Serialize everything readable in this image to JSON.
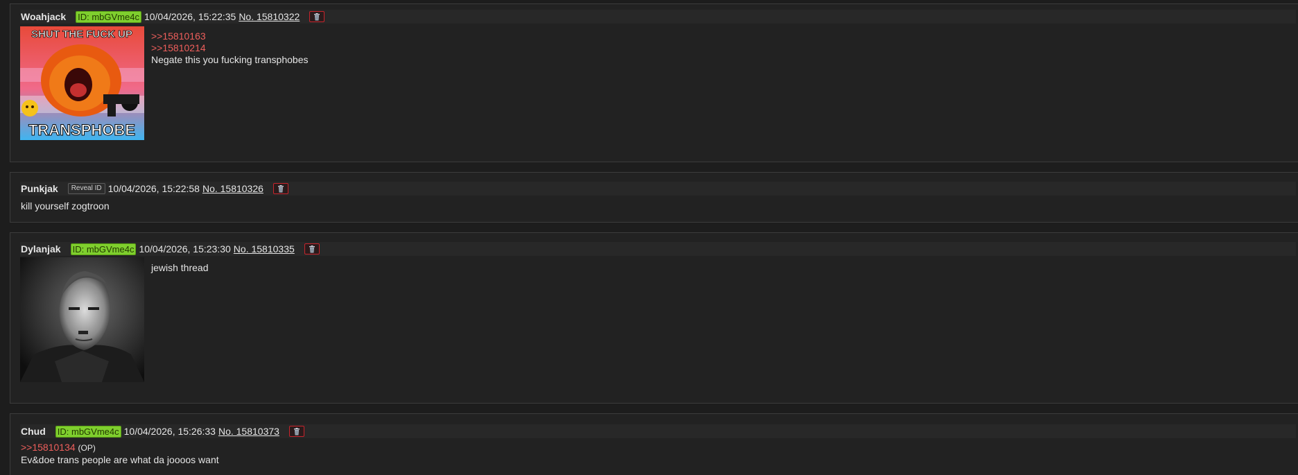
{
  "colors": {
    "background": "#1d1d1d",
    "post_background": "#222222",
    "header_background": "#282828",
    "id_badge": "#7fcf2e",
    "quote_link": "#ef5f5c",
    "delete_border": "#c8242c"
  },
  "posts": [
    {
      "name": "Woahjack",
      "id_label": "ID: mbGVme4c",
      "datetime": "10/04/2026, 15:22:35",
      "post_number": "No. 15810322",
      "delete_icon": "trash-icon",
      "image_overlay_top": "SHUT THE FUCK UP",
      "image_overlay_bottom": "TRANSPHOBE",
      "quotes": [
        ">>15810163",
        ">>15810214"
      ],
      "text": "Negate this you fucking transphobes"
    },
    {
      "name": "Punkjak",
      "reveal_label": "Reveal ID",
      "datetime": "10/04/2026, 15:22:58",
      "post_number": "No. 15810326",
      "delete_icon": "trash-icon",
      "text": "kill yourself zogtroon"
    },
    {
      "name": "Dylanjak",
      "id_label": "ID: mbGVme4c",
      "datetime": "10/04/2026, 15:23:30",
      "post_number": "No. 15810335",
      "delete_icon": "trash-icon",
      "text": "jewish thread"
    },
    {
      "name": "Chud",
      "id_label": "ID: mbGVme4c",
      "datetime": "10/04/2026, 15:26:33",
      "post_number": "No. 15810373",
      "delete_icon": "trash-icon",
      "quote": ">>15810134",
      "quote_tag": "(OP)",
      "text": "Ev&doe trans people are what da joooos want"
    }
  ]
}
